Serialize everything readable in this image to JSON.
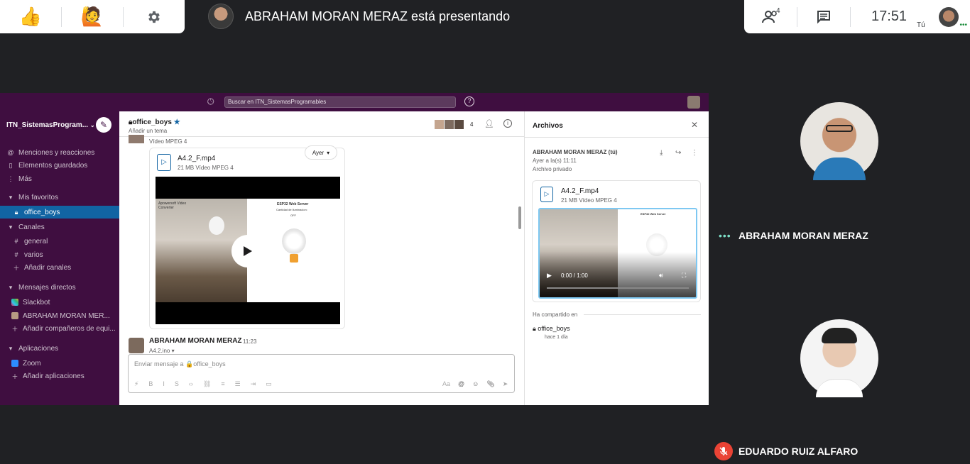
{
  "meet": {
    "reactions": {
      "thumbs": "👍",
      "hand": "🙋"
    },
    "presenting_text": "ABRAHAM MORAN MERAZ está presentando",
    "people_count": "4",
    "time": "17:51",
    "self_label": "Tú",
    "participants": [
      {
        "name": "ABRAHAM MORAN MERAZ"
      },
      {
        "name": "EDUARDO RUIZ ALFARO"
      }
    ]
  },
  "slack": {
    "search_placeholder": "Buscar en ITN_SistemasProgramables",
    "workspace": "ITN_SistemasProgram...",
    "sidebar": {
      "top_items": [
        "Menciones y reacciones",
        "Elementos guardados",
        "Más"
      ],
      "favorites_header": "Mis favoritos",
      "favorites": [
        "office_boys"
      ],
      "channels_header": "Canales",
      "channels": [
        "general",
        "varios"
      ],
      "add_channels": "Añadir canales",
      "dm_header": "Mensajes directos",
      "dms": [
        "Slackbot",
        "ABRAHAM MORAN MER..."
      ],
      "add_teammates": "Añadir compañeros de equi...",
      "apps_header": "Aplicaciones",
      "apps": [
        "Zoom"
      ],
      "add_apps": "Añadir aplicaciones"
    },
    "channel": {
      "name": "office_boys",
      "topic": "Añadir un tema",
      "member_count": "4",
      "prev_type": "Vídeo MPEG 4",
      "date_pill": "Ayer",
      "file_name": "A4.2_F.mp4",
      "file_meta": "21 MB Vídeo MPEG 4",
      "video": {
        "brand": "Apowersoft Video Converter",
        "panel_title": "ESP32 Web Server",
        "panel_sub": "Cantidad de iluminacion:",
        "panel_value": "OFF"
      },
      "msg_author": "ABRAHAM MORAN MERAZ",
      "msg_time": "11:23",
      "msg_file": "A4.2.ino",
      "composer_placeholder": "Enviar mensaje a 🔒office_boys"
    },
    "files_panel": {
      "title": "Archivos",
      "owner": "ABRAHAM MORAN MERAZ (tú)",
      "when": "Ayer a la(s) 11:11",
      "privacy": "Archivo privado",
      "file_name": "A4.2_F.mp4",
      "file_meta": "21 MB Vídeo MPEG 4",
      "player_time": "0:00 / 1:00",
      "shared_in_label": "Ha compartido en",
      "shared_channel": "office_boys",
      "shared_when": "hace 1 día"
    }
  }
}
